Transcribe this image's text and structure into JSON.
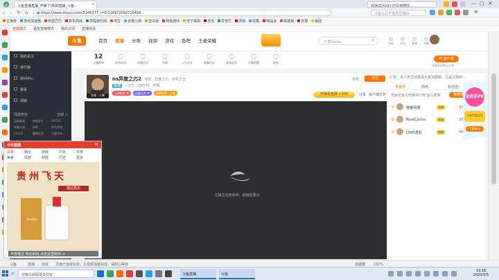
{
  "browser": {
    "tab_active": "斗鱼直播直播_开播了!我的直播_斗鱼...",
    "tab_second": "转换成功24小时后被删除...",
    "url": "https://www.douyu.com/5245377_r=0.216972092715438",
    "search_hint": "斗鱼以后不能再开播的...",
    "favorites": [
      "主播夜",
      "游戏加速器",
      "阿里巴巴",
      "京东商城",
      "携程旅行网",
      "淘宝",
      "去哪儿网",
      "亚马逊",
      "网易游戏",
      "苏宁易购",
      "当当",
      "爱奇艺",
      "网易",
      "优酷",
      "唯品会",
      "蘑菇街",
      "天猫",
      "美团"
    ],
    "site_tabs": [
      "直播模式",
      "语音直播模式",
      "我的订阅",
      "直播频道"
    ]
  },
  "site": {
    "logo": "斗鱼",
    "nav": [
      "首页",
      "直播",
      "分类",
      "视频",
      "游戏",
      "鱼吧",
      "王者荣耀"
    ],
    "sub_nav": [
      {
        "num": "12",
        "label": "主播榜单"
      },
      {
        "label": "发布动态"
      },
      {
        "label": "鱼塘活动"
      },
      {
        "label": "鱼塘"
      },
      {
        "label": "火力全开"
      },
      {
        "label": "赛事活动"
      },
      {
        "label": "超值返利"
      },
      {
        "label": "开播提醒"
      },
      {
        "label": "更多"
      }
    ],
    "search_placeholder": "王者Game",
    "header_right": [
      "历史",
      "关注",
      "客服",
      "开播"
    ],
    "pc_client": "PC客户端",
    "pc_client_sub": "直播更流畅无卡顿"
  },
  "sidebar": {
    "items": [
      "我的关注",
      "排行榜",
      "房间中心",
      "赛事",
      "漫画"
    ],
    "section_label": "网游竞技",
    "section_more": "全部 >",
    "games": [
      "英雄联盟",
      "绝地求生",
      "DOTA2",
      "穿越火线",
      "DNF",
      "炉石传说",
      "CS:GO",
      "魔兽世界",
      "守望先锋"
    ]
  },
  "room": {
    "avatar_label": "鱼塘 | 主播",
    "title": "ns异度之刃2",
    "category": "单机",
    "meta1": "异度之刃 · 单机之王",
    "badge": "鱼塘",
    "hot": "2万",
    "followers": "6775",
    "rank": "开播",
    "level_tag": "等级",
    "tags": [
      "玩家推荐 ♥",
      "超级玩家 ♥",
      "赛事推荐 | 主播"
    ],
    "report": "举报",
    "follow": "关注",
    "follow_count": "3748",
    "promo_btn": "开播看直播 +300",
    "share": "分享",
    "client": "客户端打开"
  },
  "video": {
    "loading_text": "主播正在连线中，请稍后重试"
  },
  "chat": {
    "notice": "公告：本人无主动邀请大家加群聊，凡是以我的...",
    "tabs": [
      "贡献榜",
      "周榜",
      "粉丝团"
    ],
    "list_header": "贡献者鱼丸增量排行榜 鱼丸数量",
    "top_btn": "鱼塘排行",
    "rows": [
      {
        "name": "猫猫师傅",
        "badge": "鱼塘",
        "value": "223"
      },
      {
        "name": "RoseCarina",
        "badge": "鱼塘",
        "value": "100"
      },
      {
        "name": "DIMS君影",
        "badge": "鱼塘",
        "value": "40"
      }
    ]
  },
  "side_ad": {
    "title": "全民乐PK",
    "line": "斗鱼月度冠军",
    "btn": "立即参与"
  },
  "popup": {
    "title": "今日直播",
    "tabs_row1": [
      "头条",
      "娱乐",
      "游戏",
      "户外",
      "体育"
    ],
    "tabs_row2": [
      "美食",
      "情感",
      "财经",
      "历史",
      "更多"
    ],
    "ad_big": "贵州飞天",
    "ad_small": "错过再无",
    "ad_caption": "贵州茅台",
    "footer": "不容错过 现在就抢 点击这里购买 ⊙"
  },
  "statusbar": {
    "left": "斗鱼",
    "items": [
      "直播",
      "完成",
      "页面已加载完成，主视频加载完成，请耐心等待"
    ],
    "right": [
      "加速器",
      "100%"
    ]
  },
  "taskbar": {
    "search_placeholder": "搜索以获取更多内容",
    "clock_time": "19:18",
    "clock_date": "2020/5/5",
    "app_labels": [
      "斗鱼直播",
      "斗鱼"
    ]
  },
  "colors": {
    "accent": "#ff7700",
    "sidebar_bg": "#2b2e36",
    "taskbar_bg": "#dfe8f4",
    "video_bg": "#2e2e30"
  }
}
